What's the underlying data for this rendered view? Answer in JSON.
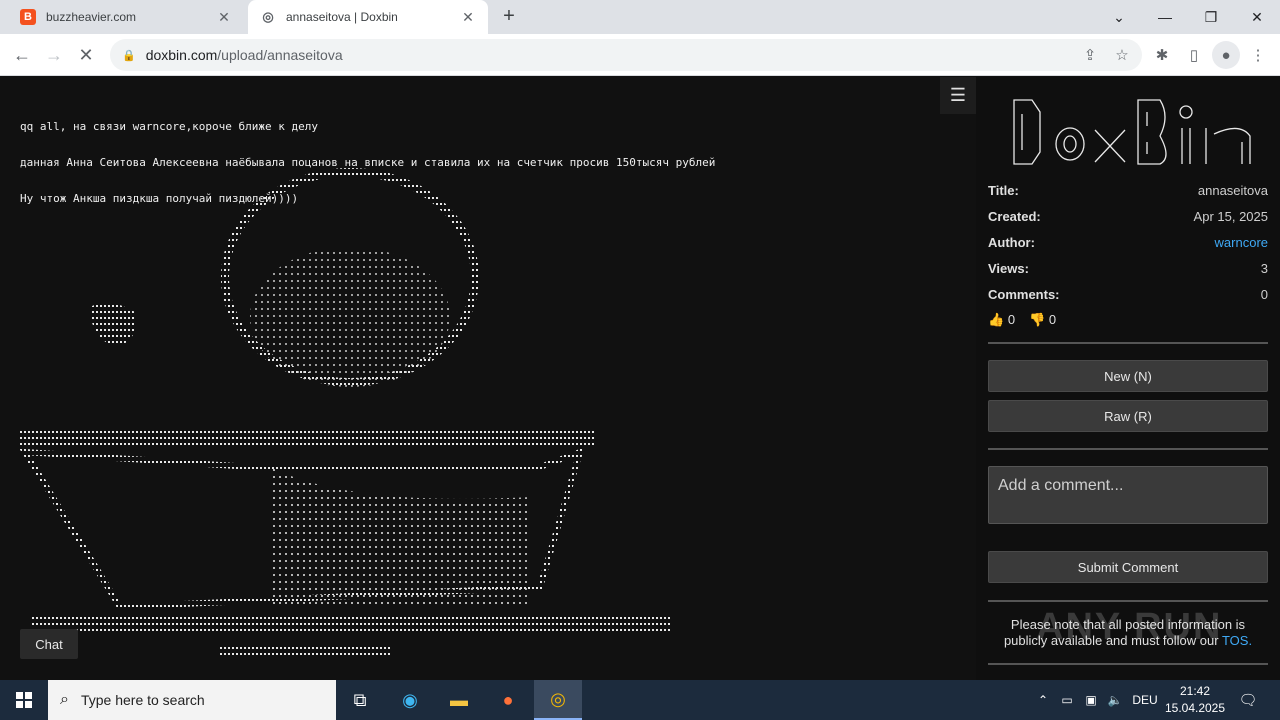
{
  "browser": {
    "tabs": [
      {
        "title": "buzzheavier.com",
        "favicon": "B",
        "active": false
      },
      {
        "title": "annaseitova | Doxbin",
        "active": true
      }
    ],
    "url_host": "doxbin.com",
    "url_path": "/upload/annaseitova"
  },
  "paste": {
    "lines": [
      "qq all, на связи warncore,короче ближе к делу",
      "данная Анна Сеитова Алексеевна наёбывала поцанов на вписке и ставила их на счетчик просив 150тысяч рублей",
      "Ну чтож Анкша пиздкша получай пиздюлей))))"
    ]
  },
  "sidebar": {
    "meta": [
      {
        "key": "Title:",
        "value": "annaseitova"
      },
      {
        "key": "Created:",
        "value": "Apr 15, 2025"
      },
      {
        "key": "Author:",
        "value": "warncore"
      },
      {
        "key": "Views:",
        "value": "3"
      },
      {
        "key": "Comments:",
        "value": "0"
      }
    ],
    "likes": "0",
    "dislikes": "0",
    "new_button": "New (N)",
    "raw_button": "Raw (R)",
    "comment_placeholder": "Add a comment...",
    "submit_button": "Submit Comment",
    "note_text": "Please note that all posted information is publicly available and must follow our",
    "note_link": "TOS."
  },
  "chat_button": "Chat",
  "watermark": "ANY RUN",
  "taskbar": {
    "search_placeholder": "Type here to search",
    "language": "DEU",
    "time": "21:42",
    "date": "15.04.2025"
  }
}
